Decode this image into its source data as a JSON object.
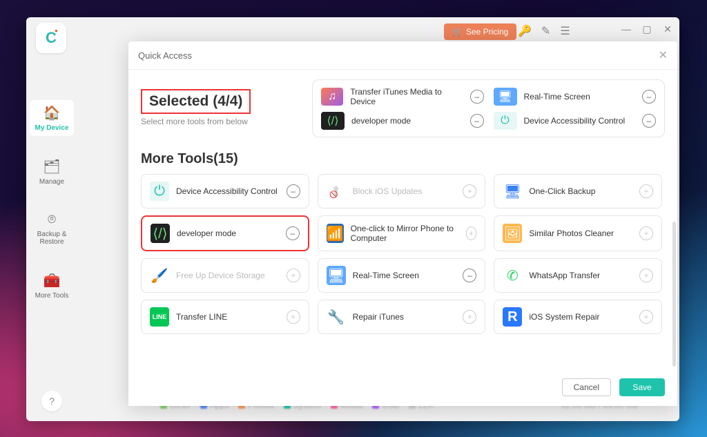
{
  "app": {
    "see_pricing": "See Pricing"
  },
  "sidebar": {
    "items": [
      {
        "label": "My Device"
      },
      {
        "label": "Manage"
      },
      {
        "label": "Backup & Restore"
      },
      {
        "label": "More Tools"
      }
    ]
  },
  "modal": {
    "title": "Quick Access",
    "selected_label": "Selected (4/4)",
    "selected_sub": "Select more tools from below",
    "selected_items": [
      {
        "label": "Transfer iTunes Media to Device"
      },
      {
        "label": "Real-Time Screen"
      },
      {
        "label": "developer mode"
      },
      {
        "label": "Device Accessibility Control"
      }
    ],
    "more_head": "More Tools(15)",
    "more_items": [
      {
        "label": "Device Accessibility Control",
        "sel": true
      },
      {
        "label": "Block iOS Updates",
        "dim": true
      },
      {
        "label": "One-Click Backup"
      },
      {
        "label": "developer mode",
        "sel": true,
        "red": true
      },
      {
        "label": "One-click to Mirror Phone to Computer"
      },
      {
        "label": "Similar Photos Cleaner"
      },
      {
        "label": "Free Up Device Storage",
        "dim": true
      },
      {
        "label": "Real-Time Screen",
        "sel": true
      },
      {
        "label": "WhatsApp Transfer"
      },
      {
        "label": "Transfer LINE"
      },
      {
        "label": "Repair iTunes"
      },
      {
        "label": "iOS System Repair"
      }
    ],
    "cancel": "Cancel",
    "save": "Save"
  },
  "bottom": {
    "tags": [
      "Other",
      "Apps",
      "Photos",
      "System",
      "Media",
      "USB",
      "LLK"
    ],
    "storage": "32.00 GB / 64.00 GB"
  }
}
